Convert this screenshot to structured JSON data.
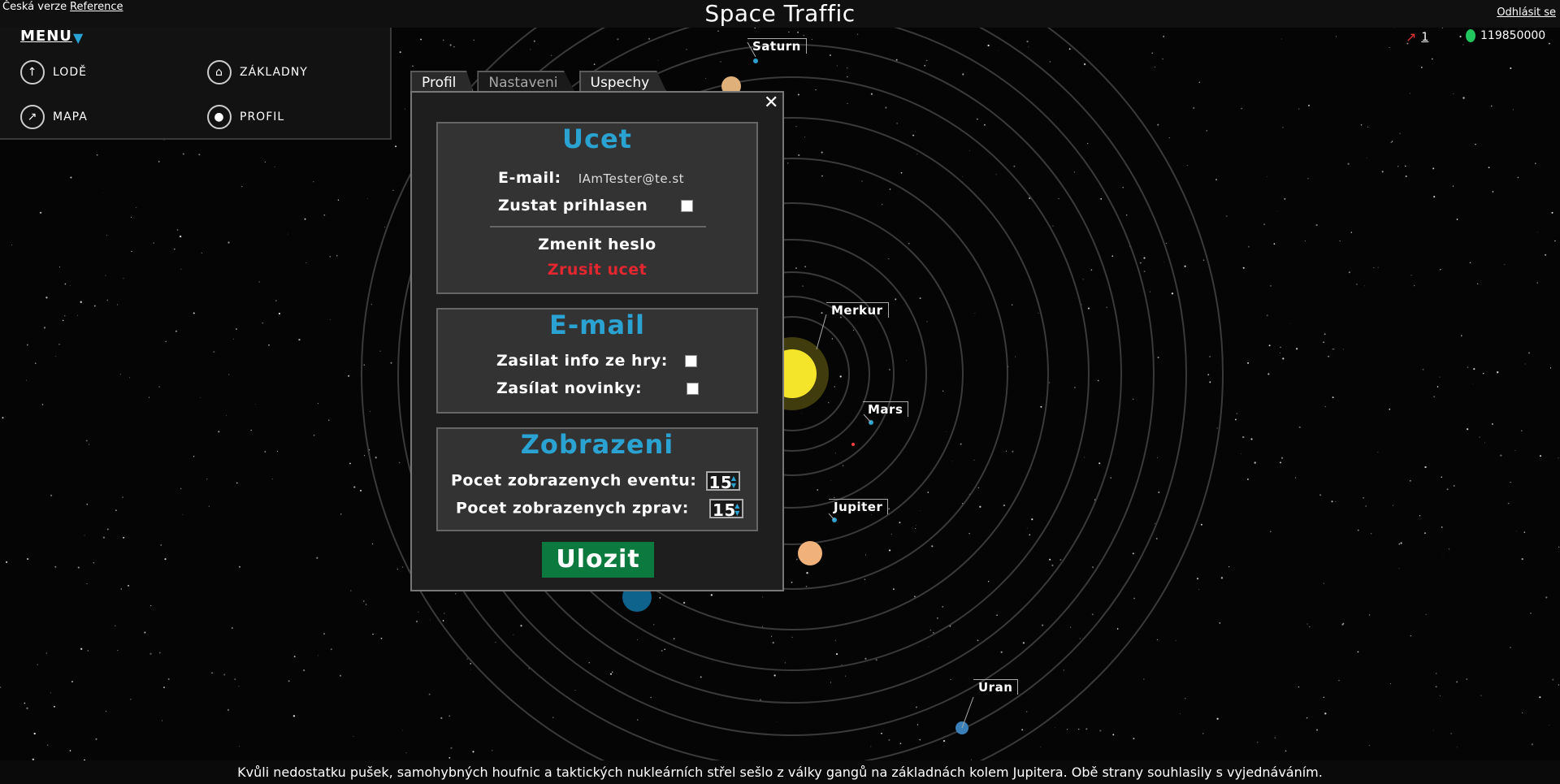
{
  "topbar": {
    "lang_label": "Česká verze",
    "reference_label": "Reference",
    "title": "Space Traffic",
    "logout_label": "Odhlásit se"
  },
  "stats": {
    "ships_count": "1",
    "credits": "119850000",
    "rocket_icon_color": "#e3342f",
    "credits_icon_color": "#22c55e"
  },
  "menu": {
    "title": "MENU",
    "items": [
      {
        "label": "LODĚ",
        "icon": "rocket-icon"
      },
      {
        "label": "ZÁKLADNY",
        "icon": "base-icon"
      },
      {
        "label": "MAPA",
        "icon": "compass-icon"
      },
      {
        "label": "PROFIL",
        "icon": "user-icon"
      }
    ]
  },
  "planets": {
    "saturn": "Saturn",
    "merkur": "Merkur",
    "mars": "Mars",
    "jupiter": "Jupiter",
    "uran": "Uran"
  },
  "dialog": {
    "tabs": [
      "Profil",
      "Nastaveni",
      "Uspechy"
    ],
    "active_tab": "Nastaveni",
    "account": {
      "heading": "Ucet",
      "email_label": "E-mail:",
      "email_value": "IAmTester@te.st",
      "stay_logged_label": "Zustat prihlasen",
      "change_password": "Zmenit heslo",
      "delete_account": "Zrusit ucet"
    },
    "email": {
      "heading": "E-mail",
      "send_info_label": "Zasilat info ze hry:",
      "send_news_label": "Zasílat novinky:"
    },
    "display": {
      "heading": "Zobrazeni",
      "events_label": "Pocet zobrazenych eventu:",
      "events_value": "15",
      "messages_label": "Pocet zobrazenych zprav:",
      "messages_value": "15"
    },
    "save_label": "Ulozit"
  },
  "footer": {
    "news": "Kvůli nedostatku pušek, samohybných houfnic a taktických nukleárních střel sešlo z války gangů na základnách kolem Jupitera. Obě strany souhlasily s vyjednáváním."
  },
  "colors": {
    "accent": "#2aa3d2",
    "danger": "#e3262f",
    "save": "#0c7a3e",
    "sun": "#f5e52a"
  }
}
